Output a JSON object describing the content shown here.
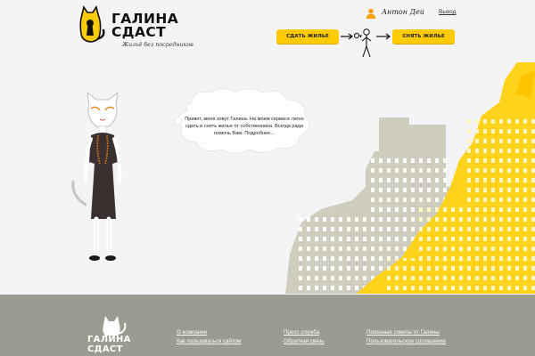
{
  "header": {
    "logo_line1": "ГАЛИНА",
    "logo_line2": "СДАСТ",
    "tagline": "Жильё без посредников",
    "user_name": "Антон Дей",
    "logout_label": "Выход",
    "rent_out_label": "СДАТЬ ЖИЛЬЕ",
    "rent_label": "СНЯТЬ ЖИЛЬЕ"
  },
  "intro": {
    "bubble_text": "Привет, меня зовут Галина. На моем сервисе легко сдать и снять жилье от собственника. Всегда рада помочь Вам. Подробнее..."
  },
  "footer": {
    "logo_line1": "ГАЛИНА",
    "logo_line2": "СДАСТ",
    "links": [
      "О компании",
      "Как пользоваться сайтом",
      "Пресс служба",
      "Обратная связь",
      "Полезные советы от Галины",
      "Пользовательское соглашение"
    ]
  },
  "colors": {
    "accent": "#ffcb05",
    "footer": "#9c9b90",
    "buildings_grey": "#cfcdbd",
    "buildings_yellow": "#ffd21c"
  }
}
